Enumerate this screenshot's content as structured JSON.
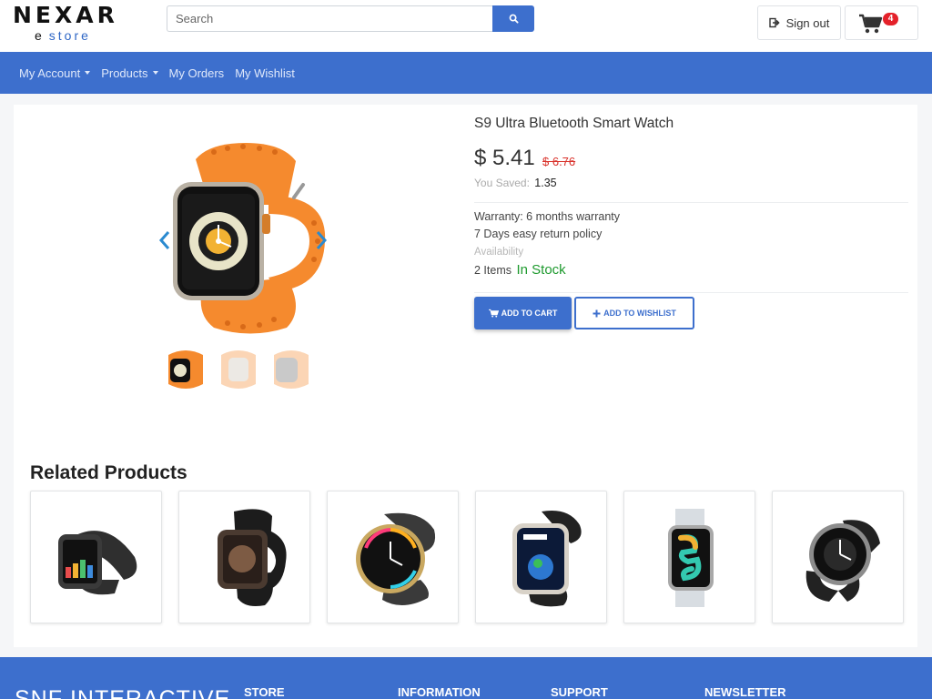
{
  "brand": {
    "name": "NEXAR",
    "prefix": "e",
    "subtitle": "store"
  },
  "search": {
    "placeholder": "Search",
    "icon": "search-icon"
  },
  "header": {
    "signout_label": "Sign out",
    "cart_count": "4"
  },
  "nav": {
    "items": [
      {
        "label": "My Account",
        "dropdown": true
      },
      {
        "label": "Products",
        "dropdown": true
      },
      {
        "label": "My Orders",
        "dropdown": false
      },
      {
        "label": "My Wishlist",
        "dropdown": false
      }
    ]
  },
  "product": {
    "title": "S9 Ultra Bluetooth Smart Watch",
    "price": "$ 5.41",
    "old_price": "$ 6.76",
    "saved_label": "You Saved:",
    "saved_value": "1.35",
    "warranty": "Warranty: 6 months warranty",
    "returns": "7 Days easy return policy",
    "availability_label": "Availability",
    "stock_count": "2 Items",
    "stock_status": "In Stock",
    "add_to_cart_label": "ADD TO CART",
    "add_to_wishlist_label": "ADD TO WISHLIST"
  },
  "related": {
    "title": "Related Products"
  },
  "footer": {
    "brand": "SNF INTERACTIVE",
    "columns": [
      "STORE",
      "INFORMATION",
      "SUPPORT",
      "NEWSLETTER"
    ]
  },
  "colors": {
    "primary": "#3d6fcd",
    "in_stock": "#1e9a2e",
    "old_price": "#d9312a",
    "cart_badge": "#e4212a",
    "watch_band": "#f58a2e"
  }
}
